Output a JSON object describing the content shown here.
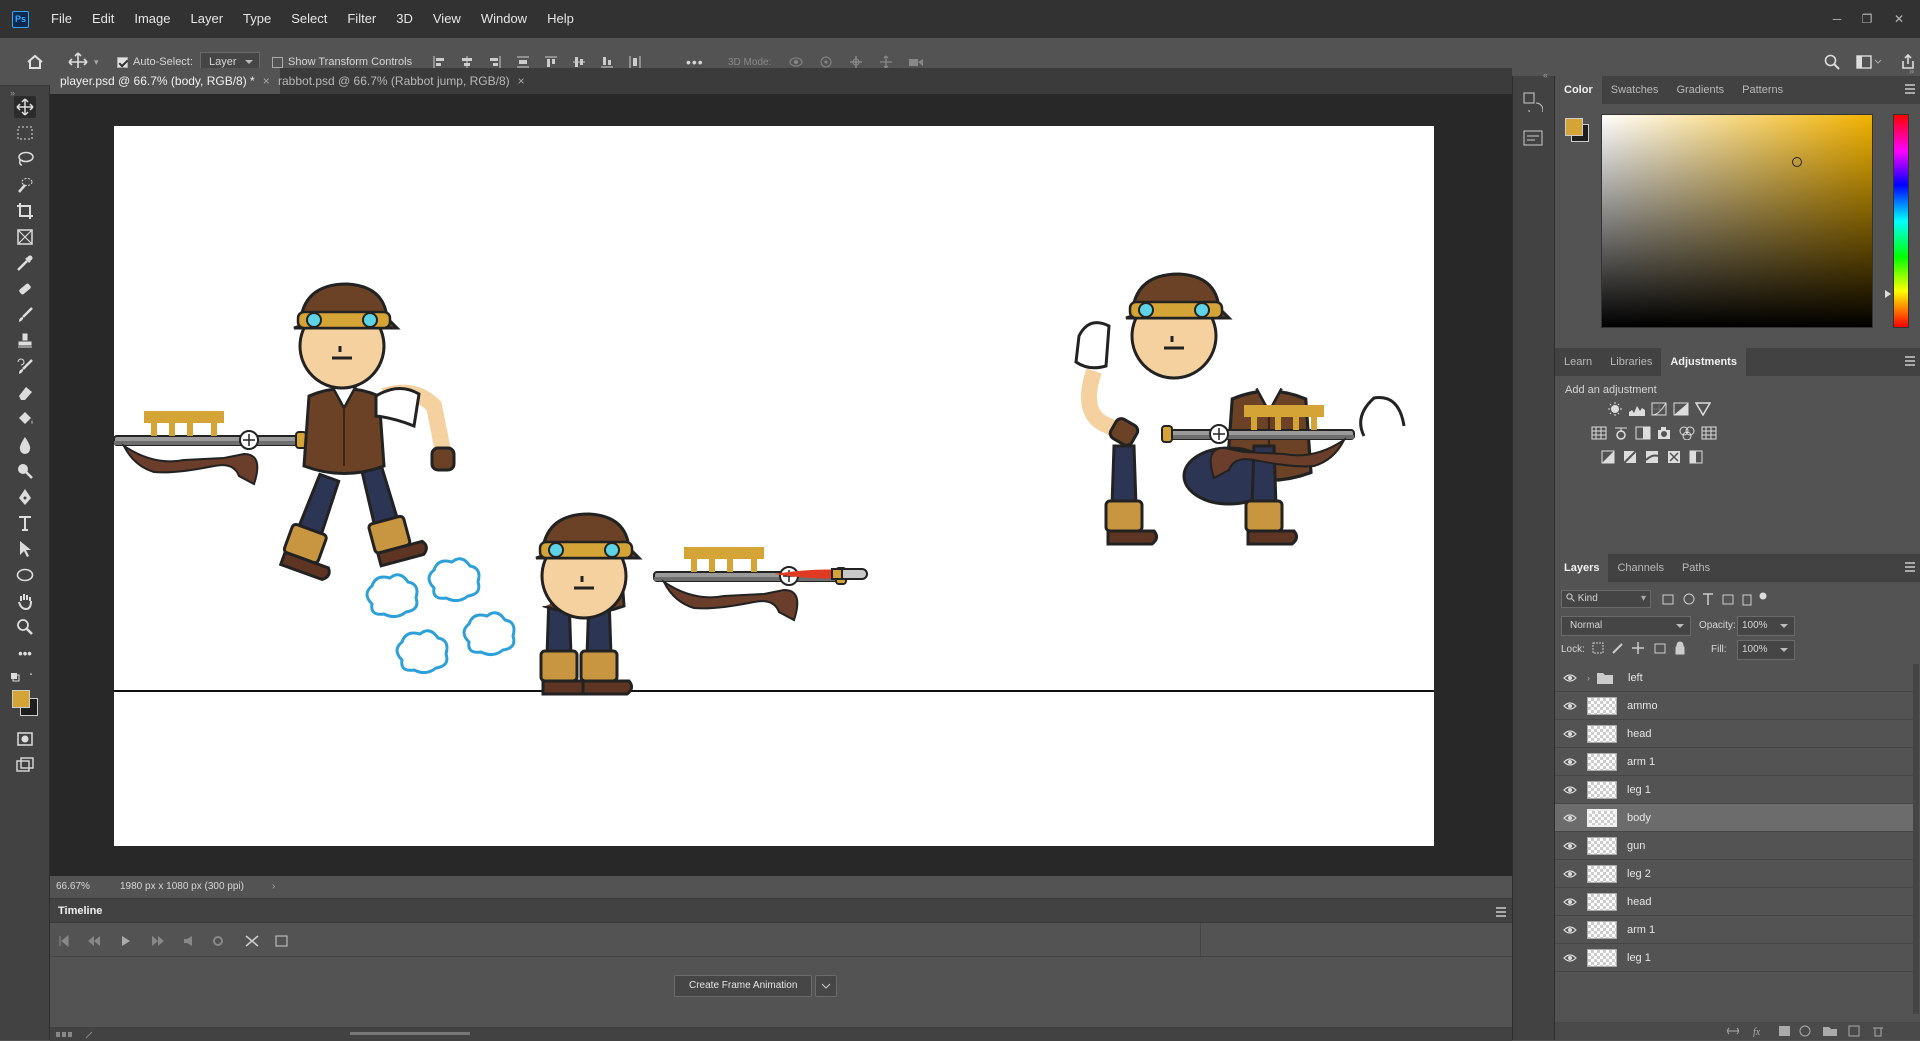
{
  "app": {
    "logo": "Ps"
  },
  "menu": [
    "File",
    "Edit",
    "Image",
    "Layer",
    "Type",
    "Select",
    "Filter",
    "3D",
    "View",
    "Window",
    "Help"
  ],
  "window_controls": {
    "minimize": "─",
    "restore": "❐",
    "close": "✕"
  },
  "options": {
    "auto_select": "Auto-Select:",
    "auto_select_target": "Layer",
    "show_transform": "Show Transform Controls",
    "more": "•••",
    "mode_3d": "3D Mode:"
  },
  "tabs": [
    {
      "label": "player.psd @ 66.7% (body, RGB/8) *",
      "close": "×"
    },
    {
      "label": "rabbot.psd @ 66.7% (Rabbot jump, RGB/8)",
      "close": "×"
    }
  ],
  "status": {
    "zoom": "66.67%",
    "doc": "1980 px x 1080 px (300 ppi)",
    "arrow": "›"
  },
  "timeline": {
    "title": "Timeline",
    "create_button": "Create Frame Animation"
  },
  "color_panel": {
    "tabs": [
      "Color",
      "Swatches",
      "Gradients",
      "Patterns"
    ],
    "foreground": "#d4a437",
    "background": "#1e1e1e",
    "hue": "#f2b200"
  },
  "adjust_panel": {
    "tabs": [
      "Learn",
      "Libraries",
      "Adjustments"
    ],
    "add_label": "Add an adjustment",
    "icons": [
      "brightness-contrast-icon",
      "levels-icon",
      "curves-icon",
      "exposure-icon",
      "vibrance-icon",
      "hue-saturation-icon",
      "color-balance-icon",
      "black-white-icon",
      "photo-filter-icon",
      "channel-mixer-icon",
      "color-lookup-icon",
      "invert-icon",
      "posterize-icon",
      "threshold-icon",
      "selective-color-icon",
      "gradient-map-icon"
    ]
  },
  "layers_panel": {
    "tabs": [
      "Layers",
      "Channels",
      "Paths"
    ],
    "kind_label": "Kind",
    "blend_mode": "Normal",
    "opacity_label": "Opacity:",
    "opacity_value": "100%",
    "lock_label": "Lock:",
    "fill_label": "Fill:",
    "fill_value": "100%",
    "layers": [
      {
        "name": "left",
        "type": "group"
      },
      {
        "name": "ammo",
        "type": "layer"
      },
      {
        "name": "head",
        "type": "layer"
      },
      {
        "name": "arm 1",
        "type": "layer"
      },
      {
        "name": "leg 1",
        "type": "layer"
      },
      {
        "name": "body",
        "type": "layer",
        "selected": true
      },
      {
        "name": "gun",
        "type": "layer"
      },
      {
        "name": "leg 2",
        "type": "layer"
      },
      {
        "name": "head",
        "type": "layer"
      },
      {
        "name": "arm 1",
        "type": "layer"
      },
      {
        "name": "leg 1",
        "type": "layer"
      }
    ]
  }
}
